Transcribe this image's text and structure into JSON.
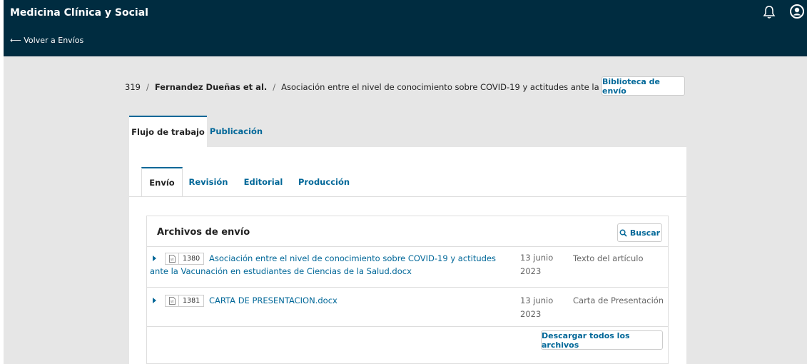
{
  "header": {
    "site_title": "Medicina Clínica y Social",
    "back_label": "⟵ Volver a Envíos"
  },
  "breadcrumb": {
    "id": "319",
    "authors": "Fernandez Dueñas et al.",
    "title": "Asociación entre el nivel de conocimiento sobre COVID-19 y actitudes ante la Vacunación",
    "library_button": "Biblioteca de envío"
  },
  "outer_tabs": [
    {
      "label": "Flujo de trabajo",
      "active": true
    },
    {
      "label": "Publicación",
      "active": false
    }
  ],
  "inner_tabs": [
    {
      "label": "Envío",
      "active": true
    },
    {
      "label": "Revisión",
      "active": false
    },
    {
      "label": "Editorial",
      "active": false
    },
    {
      "label": "Producción",
      "active": false
    }
  ],
  "files_panel": {
    "title": "Archivos de envío",
    "search_label": "Buscar",
    "download_all_label": "Descargar todos los archivos",
    "rows": [
      {
        "id": "1380",
        "name": "Asociación entre el nivel de conocimiento sobre COVID-19 y actitudes ante la Vacunación en estudiantes de Ciencias de la Salud.docx",
        "date": "13 junio 2023",
        "type": "Texto del artículo"
      },
      {
        "id": "1381",
        "name": "CARTA DE PRESENTACION.docx",
        "date": "13 junio 2023",
        "type": "Carta de Presentación"
      }
    ]
  },
  "icons": {
    "bell": "bell-icon",
    "user": "user-icon",
    "search": "search-icon",
    "file": "file-icon"
  },
  "colors": {
    "header_bg": "#002c40",
    "link": "#006798",
    "page_bg": "#e6e6e6"
  }
}
